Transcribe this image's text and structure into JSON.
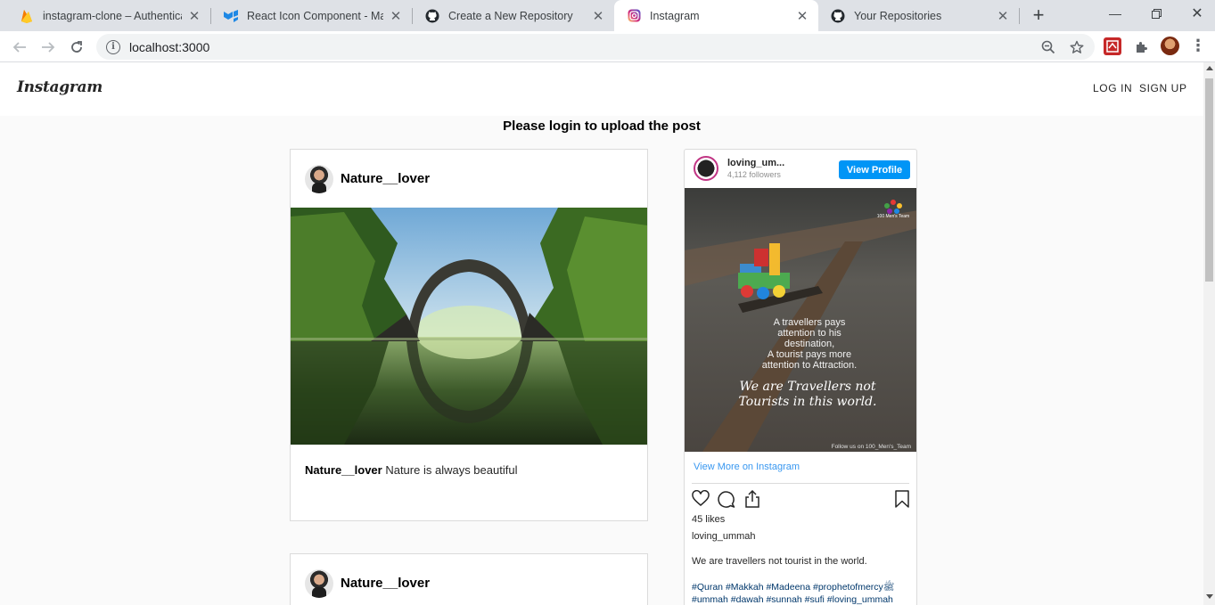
{
  "browser": {
    "tabs": [
      {
        "title": "instagram-clone – Authenticati",
        "icon": "firebase-icon"
      },
      {
        "title": "React Icon Component - Mater",
        "icon": "material-ui-icon"
      },
      {
        "title": "Create a New Repository",
        "icon": "github-icon"
      },
      {
        "title": "Instagram",
        "icon": "instagram-icon",
        "active": true
      },
      {
        "title": "Your Repositories",
        "icon": "github-icon"
      }
    ],
    "url": "localhost:3000"
  },
  "header": {
    "logo": "Instagram",
    "login_label": "LOG IN",
    "signup_label": "SIGN UP"
  },
  "upload_message": "Please login to upload the post",
  "posts": [
    {
      "username": "Nature__lover",
      "caption_user": "Nature__lover",
      "caption_text": " Nature is always beautiful"
    },
    {
      "username": "Nature__lover"
    }
  ],
  "embed": {
    "username": "loving_um...",
    "followers": "4,112 followers",
    "view_profile_label": "View Profile",
    "image_text": {
      "brand": "100 Men's Team",
      "quote": [
        "A travellers pays",
        "attention to his",
        "destination,",
        "A tourist pays more",
        "attention to Attraction."
      ],
      "script": [
        "We are Travellers not",
        "Tourists in this world."
      ],
      "footer": "Follow us on  100_Men's_Team"
    },
    "view_more_label": "View More on Instagram",
    "likes": "45 likes",
    "owner": "loving_ummah",
    "text": "We are travellers not tourist in the world.",
    "tags_line1": "#Quran #Makkah #Madeena #prophetofmercyﷺ",
    "tags_line2": "#ummah #dawah #sunnah #sufi #loving_ummah"
  },
  "colors": {
    "accent_blue": "#0095f6",
    "link_blue": "#3897f0",
    "page_bg": "#fafafa",
    "border": "#dbdbdb"
  }
}
